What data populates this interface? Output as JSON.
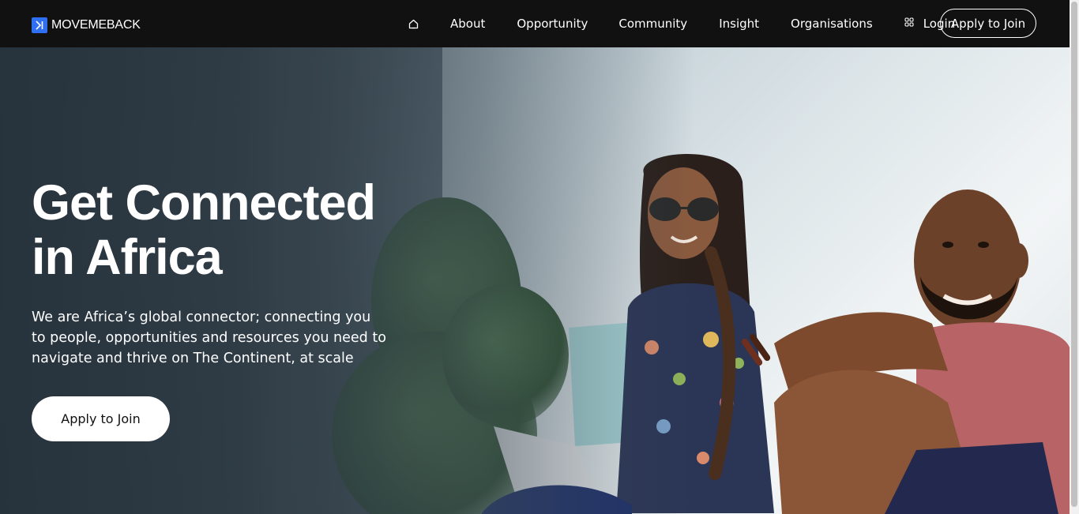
{
  "brand": {
    "name": "MOVEMEBACK",
    "accent": "#2f6ff2"
  },
  "nav": {
    "home_icon": "home-icon",
    "items": [
      {
        "label": "About"
      },
      {
        "label": "Opportunity"
      },
      {
        "label": "Community"
      },
      {
        "label": "Insight"
      },
      {
        "label": "Organisations"
      }
    ],
    "login_icon": "apps-grid-icon",
    "login_label": "Login",
    "apply_label": "Apply to Join"
  },
  "hero": {
    "title_line1": "Get Connected",
    "title_line2": "in Africa",
    "subtitle": "We are Africa’s global connector; connecting you to people, opportunities and resources you need to navigate and thrive on The Continent, at scale",
    "cta_label": "Apply to Join",
    "image": "photo-two-people-seated-outdoors"
  },
  "colors": {
    "nav_bg": "#111111",
    "text": "#ffffff"
  }
}
